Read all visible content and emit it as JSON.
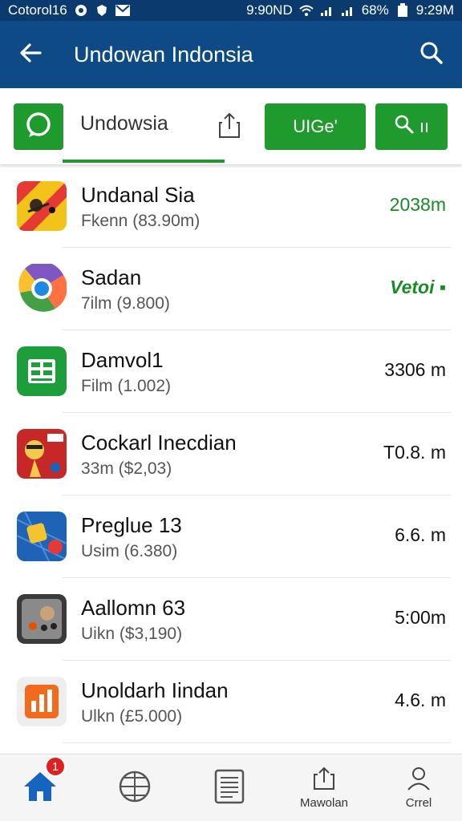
{
  "status_bar": {
    "carrier": "Cotorol16",
    "network": "9:90ND",
    "battery": "68%",
    "time": "9:29M"
  },
  "app_bar": {
    "title": "Undowan Indonsia",
    "back_icon": "arrow-left-icon",
    "search_icon": "search-icon"
  },
  "toolbar": {
    "search_tab": "Undowsia",
    "button1_label": "UIGe'",
    "button2_label": "ıı"
  },
  "rows": [
    {
      "name": "Undanal Sia",
      "sub": "Fkenn (83.90m)",
      "size": "2038m",
      "size_style": "green"
    },
    {
      "name": "Sadan",
      "sub": "7ilm (9.800)",
      "size": "Vetoi ▪",
      "size_style": "badge"
    },
    {
      "name": "Damvol1",
      "sub": "Film (1.002)",
      "size": "3306 m",
      "size_style": "normal"
    },
    {
      "name": "Cockarl Inecdian",
      "sub": "33m ($2,03)",
      "size": "T0.8. m",
      "size_style": "normal"
    },
    {
      "name": "Preglue 13",
      "sub": "Usim (6.380)",
      "size": "6.6. m",
      "size_style": "normal"
    },
    {
      "name": "Aallomn 63",
      "sub": "Uikn ($3,190)",
      "size": "5:00m",
      "size_style": "normal"
    },
    {
      "name": "Unoldarh Iindan",
      "sub": "Ulkn (£5.000)",
      "size": "4.6. m",
      "size_style": "normal"
    }
  ],
  "bottom_nav": {
    "badge_count": "1",
    "item4_label": "Mawolan",
    "item5_label": "Crrel"
  },
  "colors": {
    "primary": "#0d4a86",
    "accent_green": "#1f9a2d"
  }
}
